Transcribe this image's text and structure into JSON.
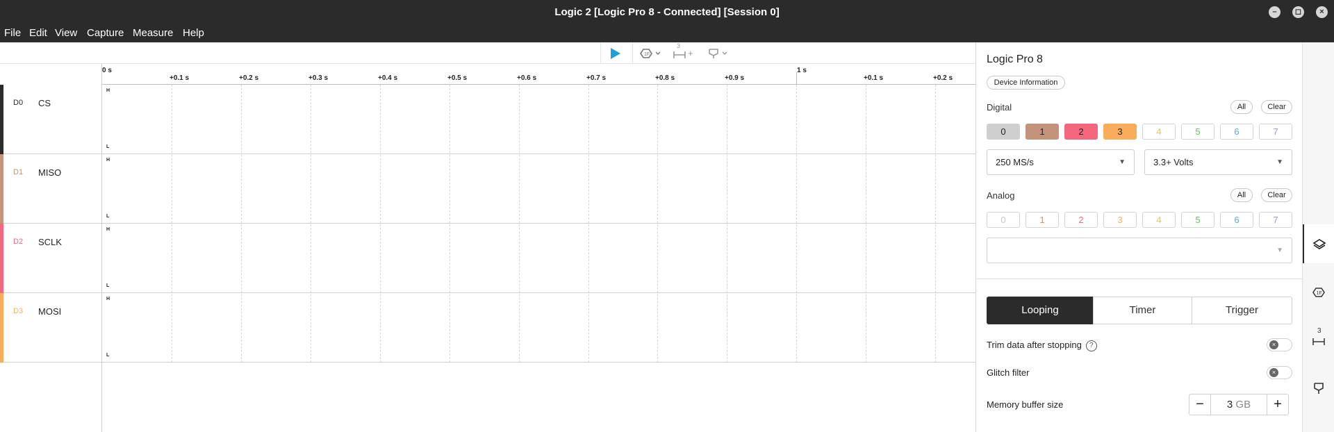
{
  "window": {
    "title": "Logic 2 [Logic Pro 8 - Connected] [Session 0]",
    "controls": {
      "minimize": "–",
      "maximize": "◻",
      "close": "×"
    }
  },
  "menu": [
    "File",
    "Edit",
    "View",
    "Capture",
    "Measure",
    "Help"
  ],
  "toolbar": {
    "timing_marker_count": "3",
    "timing_marker_add": "+"
  },
  "ruler": {
    "ticks": [
      "0 s",
      "+0.1 s",
      "+0.2 s",
      "+0.3 s",
      "+0.4 s",
      "+0.5 s",
      "+0.6 s",
      "+0.7 s",
      "+0.8 s",
      "+0.9 s",
      "1 s",
      "+0.1 s",
      "+0.2 s"
    ]
  },
  "channels": [
    {
      "id": "D0",
      "name": "CS",
      "color": "#2b2b2b",
      "high": "H",
      "low": "L"
    },
    {
      "id": "D1",
      "name": "MISO",
      "color": "#c4937c",
      "high": "H",
      "low": "L"
    },
    {
      "id": "D2",
      "name": "SCLK",
      "color": "#f5677e",
      "high": "H",
      "low": "L"
    },
    {
      "id": "D3",
      "name": "MOSI",
      "color": "#f9ad5b",
      "high": "H",
      "low": "L"
    }
  ],
  "panel": {
    "device_name": "Logic Pro 8",
    "device_info_label": "Device Information",
    "digital": {
      "label": "Digital",
      "all_label": "All",
      "clear_label": "Clear",
      "channels": [
        "0",
        "1",
        "2",
        "3",
        "4",
        "5",
        "6",
        "7"
      ],
      "enabled": [
        true,
        true,
        true,
        true,
        false,
        false,
        false,
        false
      ]
    },
    "sample_rate": "250 MS/s",
    "voltage": "3.3+ Volts",
    "analog": {
      "label": "Analog",
      "all_label": "All",
      "clear_label": "Clear",
      "channels": [
        "0",
        "1",
        "2",
        "3",
        "4",
        "5",
        "6",
        "7"
      ],
      "enabled": [
        false,
        false,
        false,
        false,
        false,
        false,
        false,
        false
      ],
      "rate": ""
    },
    "capture_modes": [
      "Looping",
      "Timer",
      "Trigger"
    ],
    "active_mode": "Looping",
    "trim_label": "Trim data after stopping",
    "trim_enabled": false,
    "glitch_label": "Glitch filter",
    "glitch_enabled": false,
    "memory_label": "Memory buffer size",
    "memory_value": "3",
    "memory_unit": "GB",
    "decrement": "−",
    "increment": "+"
  },
  "rail": {
    "items": [
      "device-settings-icon",
      "analyzers-icon",
      "timing-markers-icon",
      "annotations-icon"
    ],
    "active": "device-settings-icon",
    "timing_badge": "3"
  },
  "colors": {
    "accent": "#1e9fd6",
    "chan_colors": [
      "#cfcfcf",
      "#c4937c",
      "#f5677e",
      "#f9ad5b",
      "#f5c542",
      "#5cc65a",
      "#5aa8ee",
      "#a88ee6"
    ]
  }
}
